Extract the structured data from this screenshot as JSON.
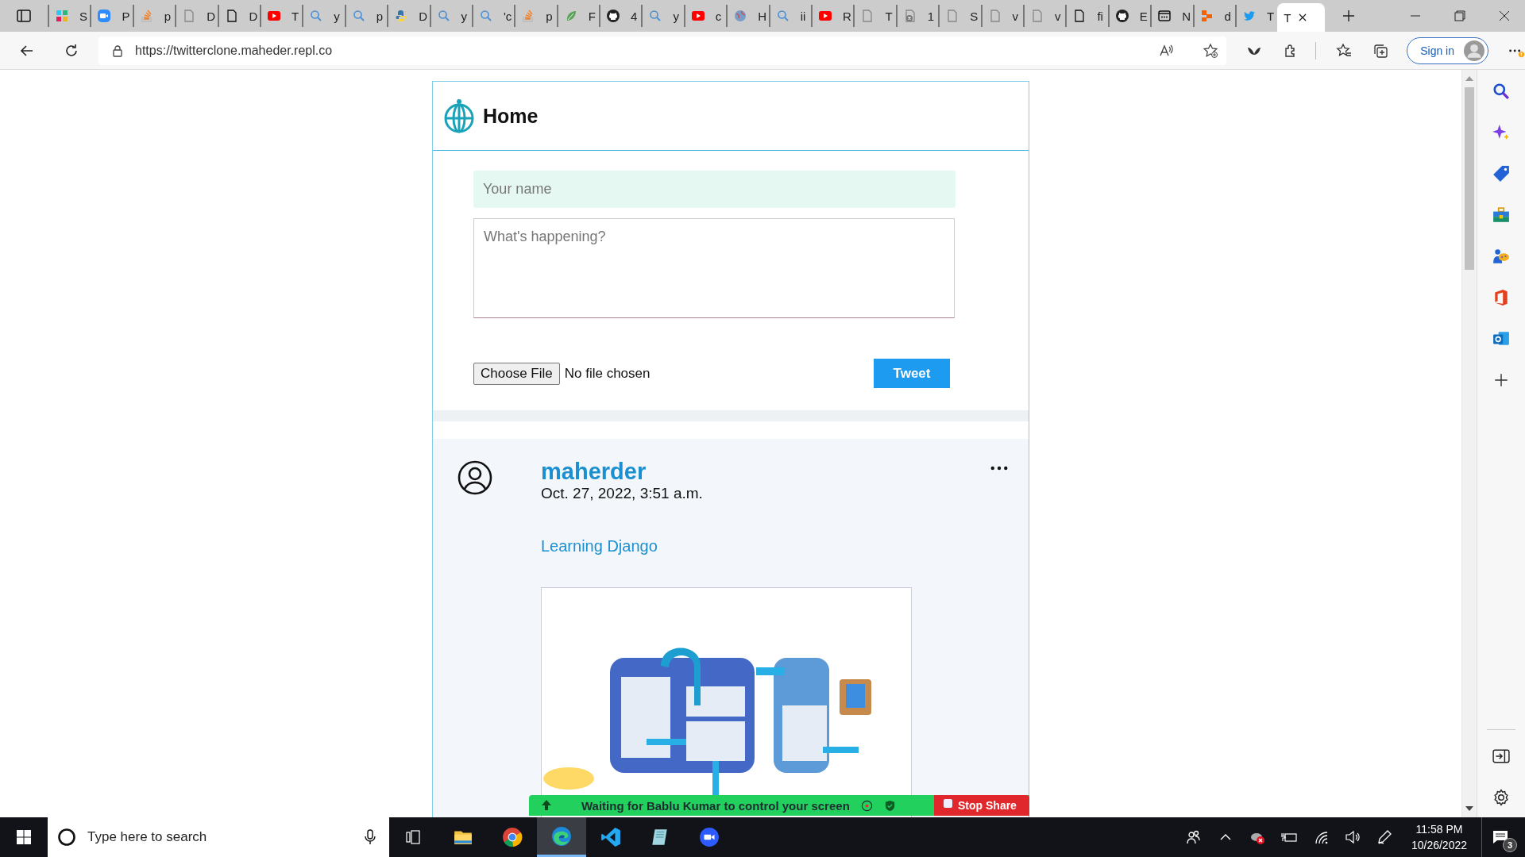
{
  "browser": {
    "tabs": [
      {
        "label": "S",
        "kind": "grid",
        "selected": false
      },
      {
        "label": "P",
        "kind": "camera",
        "selected": false
      },
      {
        "label": "p",
        "kind": "stack",
        "selected": false
      },
      {
        "label": "D",
        "kind": "page",
        "selected": false
      },
      {
        "label": "D",
        "kind": "page-dark",
        "selected": false
      },
      {
        "label": "T",
        "kind": "video",
        "selected": false
      },
      {
        "label": "y",
        "kind": "search",
        "selected": false
      },
      {
        "label": "p",
        "kind": "search",
        "selected": false
      },
      {
        "label": "D",
        "kind": "snake",
        "selected": false
      },
      {
        "label": "y",
        "kind": "search",
        "selected": false
      },
      {
        "label": "'c",
        "kind": "search",
        "selected": false
      },
      {
        "label": "p",
        "kind": "stack",
        "selected": false
      },
      {
        "label": "F",
        "kind": "leaf",
        "selected": false
      },
      {
        "label": "4",
        "kind": "cat",
        "selected": false
      },
      {
        "label": "y",
        "kind": "search",
        "selected": false
      },
      {
        "label": "c",
        "kind": "video",
        "selected": false
      },
      {
        "label": "H",
        "kind": "globe",
        "selected": false
      },
      {
        "label": "ii",
        "kind": "search",
        "selected": false
      },
      {
        "label": "R",
        "kind": "video",
        "selected": false
      },
      {
        "label": "T",
        "kind": "page",
        "selected": false
      },
      {
        "label": "1",
        "kind": "page-error",
        "selected": false
      },
      {
        "label": "S",
        "kind": "page",
        "selected": false
      },
      {
        "label": "v",
        "kind": "page",
        "selected": false
      },
      {
        "label": "v",
        "kind": "page",
        "selected": false
      },
      {
        "label": "fi",
        "kind": "page-dark",
        "selected": false
      },
      {
        "label": "E",
        "kind": "cat",
        "selected": false
      },
      {
        "label": "N",
        "kind": "window",
        "selected": false
      },
      {
        "label": "d",
        "kind": "blocks",
        "selected": false
      },
      {
        "label": "T",
        "kind": "bird",
        "selected": false
      },
      {
        "label": "T",
        "kind": "blank",
        "selected": true
      }
    ],
    "url": "https://twitterclone.maheder.repl.co",
    "sign_in": "Sign in"
  },
  "page": {
    "header": {
      "title": "Home"
    },
    "composer": {
      "name_placeholder": "Your name",
      "text_placeholder": "What's happening?",
      "file_button": "Choose File",
      "file_status": "No file chosen",
      "submit": "Tweet"
    },
    "posts": [
      {
        "username": "maherder",
        "date": "Oct. 27, 2022, 3:51 a.m.",
        "text": "Learning Django"
      }
    ]
  },
  "share_bar": {
    "message": "Waiting for Bablu Kumar to control your screen",
    "stop": "Stop Share"
  },
  "taskbar": {
    "search_placeholder": "Type here to search",
    "apps": [
      {
        "kind": "folder",
        "selected": false
      },
      {
        "kind": "ball",
        "selected": false
      },
      {
        "kind": "wave",
        "selected": true
      },
      {
        "kind": "code",
        "selected": false
      },
      {
        "kind": "note",
        "selected": false
      },
      {
        "kind": "video-circle",
        "selected": false
      }
    ],
    "time": "11:58 PM",
    "date": "10/26/2022",
    "notifications": "3"
  }
}
